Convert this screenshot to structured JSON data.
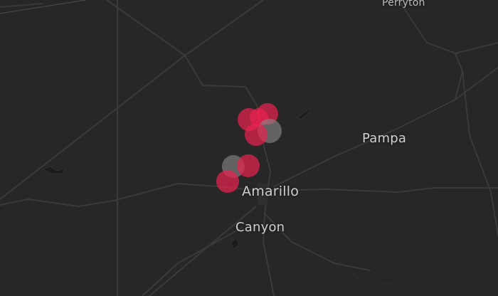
{
  "map": {
    "colors": {
      "background": "#272727",
      "road": "#3a3a3a",
      "border": "#4a4a4a",
      "marker_red": "#e8234f",
      "marker_gray": "#8c8c8c",
      "label": "#cfcfcf"
    },
    "places": {
      "perryton": "Perryton",
      "pampa": "Pampa",
      "amarillo": "Amarillo",
      "canyon": "Canyon"
    },
    "markers": [
      {
        "color": "red"
      },
      {
        "color": "red"
      },
      {
        "color": "red"
      },
      {
        "color": "red"
      },
      {
        "color": "gray"
      },
      {
        "color": "gray"
      },
      {
        "color": "red"
      },
      {
        "color": "red"
      }
    ]
  }
}
